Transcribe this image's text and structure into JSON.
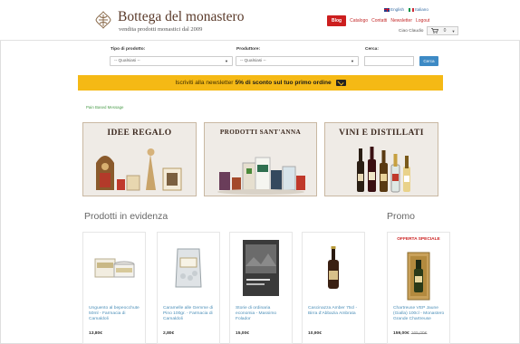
{
  "brand": {
    "title": "Bottega del monastero",
    "subtitle": "vendita prodotti monastici dal 2009"
  },
  "lang": {
    "english": "English",
    "italian": "Italiano"
  },
  "topnav": {
    "blog": "Blog",
    "catalog": "Catalogo",
    "contact": "Contatti",
    "newsletter": "Newsletter",
    "logout": "Logout"
  },
  "user": {
    "name": "Ciao Claudio",
    "cart_count": "0"
  },
  "filters": {
    "type_label": "Tipo di prodotto:",
    "type_value": "-- Qualsiasi --",
    "producer_label": "Produttore:",
    "producer_value": "-- Qualsiasi --",
    "search_label": "Cerca:",
    "search_value": "",
    "search_button": "Cerca"
  },
  "newsletter": {
    "text": "Iscriviti alla newsletter",
    "highlight": "5% di sconto sul tuo primo ordine"
  },
  "breadcrumb": "Pain Based Message",
  "categories": [
    {
      "title": "IDEE REGALO"
    },
    {
      "title": "PRODOTTI SANT'ANNA"
    },
    {
      "title": "VINI E DISTILLATI"
    }
  ],
  "sections": {
    "featured": "Prodotti in evidenza",
    "promo": "Promo"
  },
  "products": [
    {
      "name": "Unguento al bepeocchute 50ml - Farmacia di Camaldoli",
      "price": "13,80€"
    },
    {
      "name": "Caramelle alle Gemme di Pino 100gr. - Farmacia di Camaldoli",
      "price": "2,80€"
    },
    {
      "name": "Storie di ordinaria economia - Massimo Folador",
      "price": "15,00€"
    },
    {
      "name": "Cascinazza Amber 75cl - Birra d'Abbazia Ambrata",
      "price": "10,90€"
    }
  ],
  "promo": {
    "tag": "OFFERTA SPECIALE",
    "name": "Chartreuse VEP Jaune (Gialla) 100cl - Monastero Grande Chartreuse",
    "price": "159,00€",
    "old_price": "165,00€"
  },
  "colors": {
    "blog_red": "#cc1f1f",
    "banner_yellow": "#f5b915",
    "link_blue": "#4c8fb8",
    "button_blue": "#3d8ac5"
  }
}
